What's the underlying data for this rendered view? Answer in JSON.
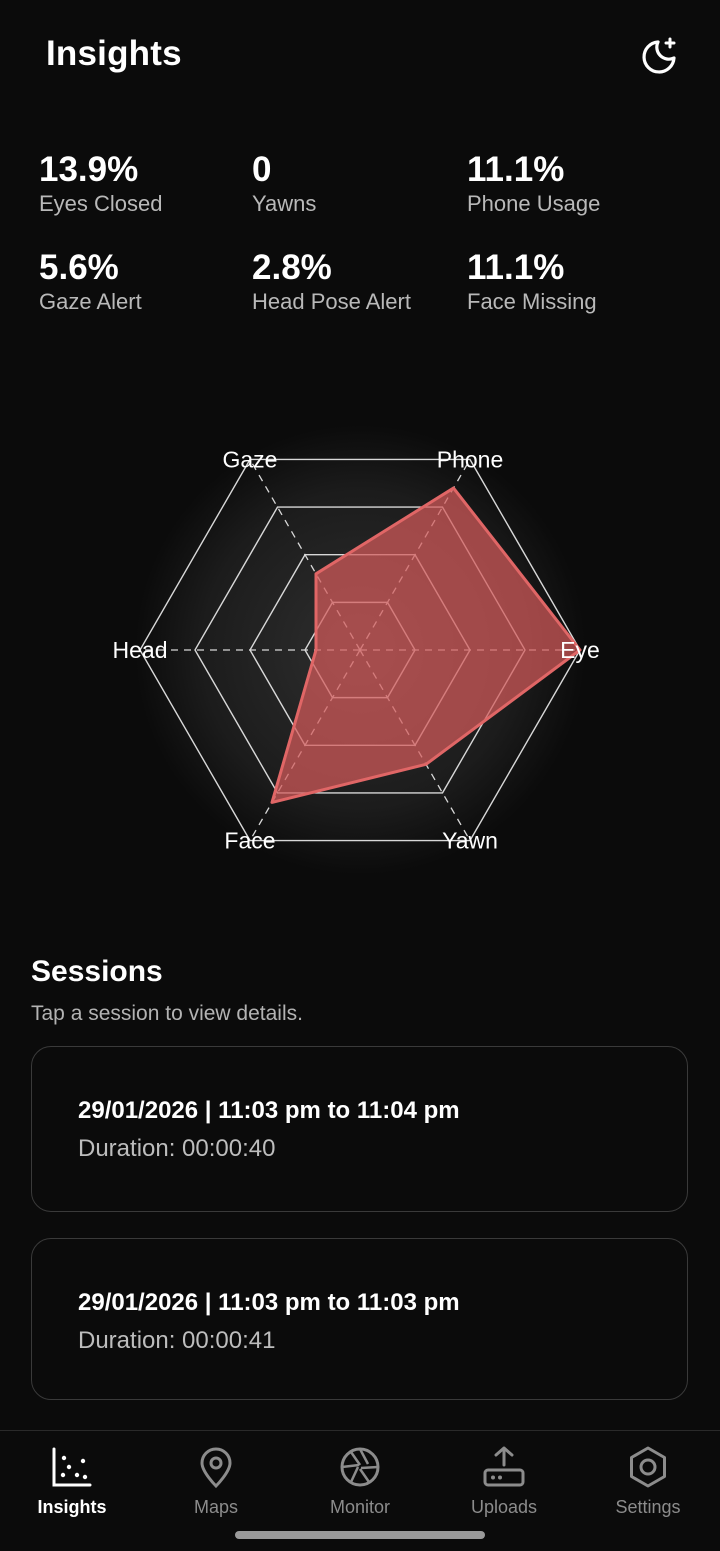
{
  "header": {
    "title": "Insights",
    "theme_icon": "moon-sparkle-icon"
  },
  "stats": [
    {
      "value": "13.9%",
      "label": "Eyes Closed"
    },
    {
      "value": "0",
      "label": "Yawns"
    },
    {
      "value": "11.1%",
      "label": "Phone Usage"
    },
    {
      "value": "5.6%",
      "label": "Gaze Alert"
    },
    {
      "value": "2.8%",
      "label": "Head Pose Alert"
    },
    {
      "value": "11.1%",
      "label": "Face Missing"
    }
  ],
  "chart_data": {
    "type": "radar",
    "axes": [
      "Eye",
      "Phone",
      "Gaze",
      "Head",
      "Face",
      "Yawn"
    ],
    "values": [
      1.0,
      0.85,
      0.4,
      0.2,
      0.8,
      0.6
    ],
    "levels": 4,
    "colors": {
      "fill": "#d45a5a",
      "stroke": "#e06666",
      "grid": "#d8d8d8"
    }
  },
  "sessions": {
    "title": "Sessions",
    "subtitle": "Tap a session to view details.",
    "items": [
      {
        "title": "29/01/2026 | 11:03 pm to 11:04 pm",
        "duration": "Duration: 00:00:40"
      },
      {
        "title": "29/01/2026 | 11:03 pm to 11:03 pm",
        "duration": "Duration: 00:00:41"
      }
    ]
  },
  "nav": {
    "active": "Insights",
    "items": [
      {
        "label": "Insights",
        "icon": "chart-scatter-icon"
      },
      {
        "label": "Maps",
        "icon": "map-pin-icon"
      },
      {
        "label": "Monitor",
        "icon": "camera-aperture-icon"
      },
      {
        "label": "Uploads",
        "icon": "upload-icon"
      },
      {
        "label": "Settings",
        "icon": "hexagon-settings-icon"
      }
    ]
  }
}
